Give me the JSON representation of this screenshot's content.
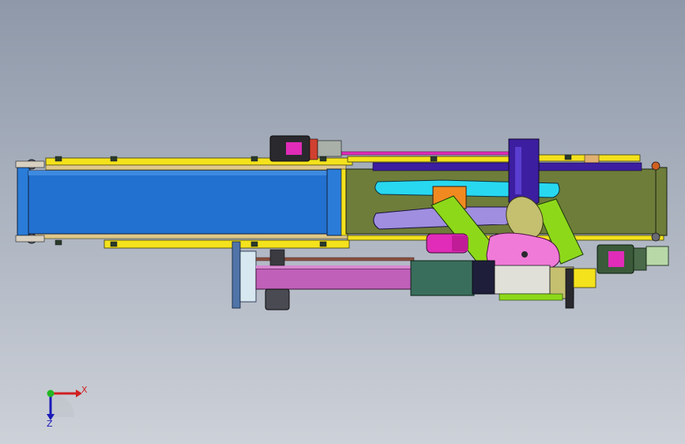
{
  "viewport": {
    "background_top": "#8e98a8",
    "background_bottom": "#cdd1d8"
  },
  "model": {
    "description_colors": {
      "conveyor_belt": "#2270d0",
      "conveyor_belt_dark": "#1a5cb0",
      "right_frame": "#6e7d3a",
      "rail_yellow": "#f4e21c",
      "rail_tan": "#e0c88a",
      "cyan_arm": "#28d8f0",
      "lavender_arm": "#a08ee0",
      "orange_block": "#f08a20",
      "green_arm": "#8ed81a",
      "khaki_disk": "#c4c070",
      "pink_plate": "#f07ad8",
      "magenta_cyl": "#e02cb8",
      "purple_tower": "#3c1ea0",
      "motor_dark": "#2a2a2e",
      "teal_box": "#3a6e5c",
      "mauve_beam": "#c060b8",
      "steel_blue": "#5074a8"
    }
  },
  "triad": {
    "x_label": "X",
    "y_label": "Z",
    "x_color": "#d02020",
    "y_color": "#1a1ab8",
    "origin_color": "#22b822"
  }
}
